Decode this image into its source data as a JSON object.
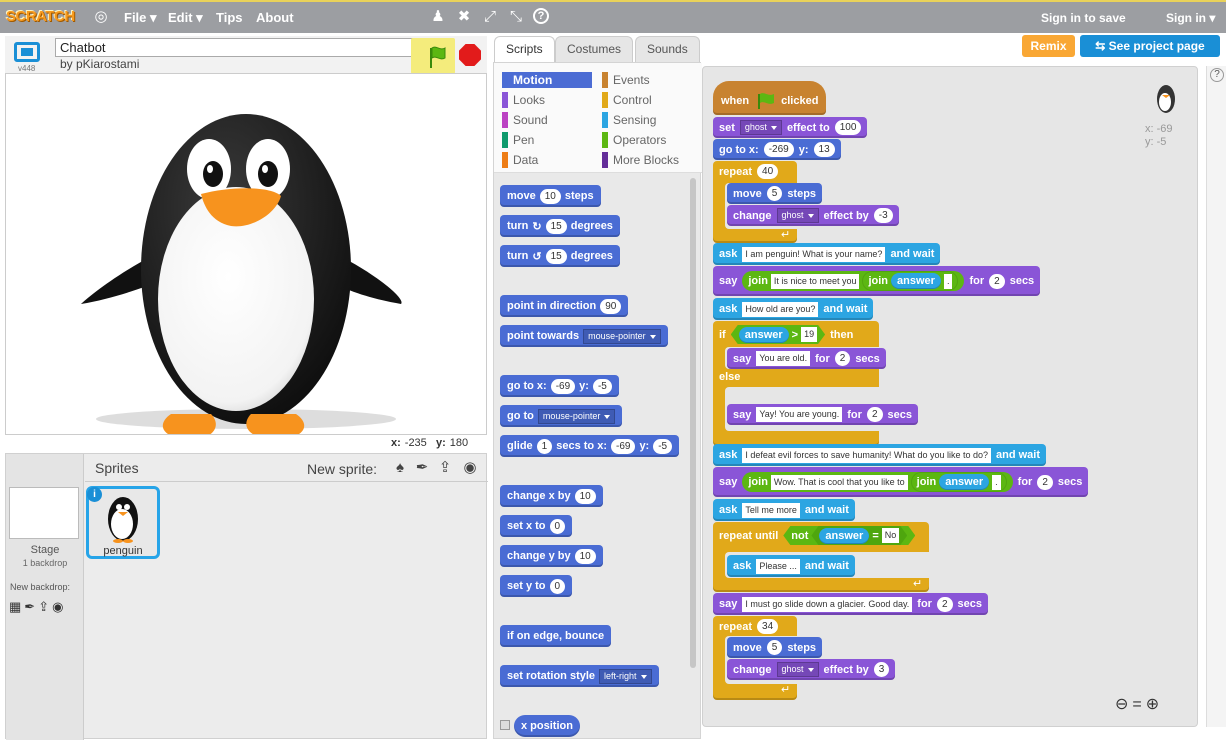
{
  "topbar": {
    "logo": "SCRATCH",
    "menu": [
      "File",
      "Edit",
      "Tips",
      "About"
    ],
    "sign_in_to_save": "Sign in to save",
    "sign_in": "Sign in",
    "icons": [
      "globe-icon",
      "duplicate-icon",
      "delete-icon",
      "grow-icon",
      "shrink-icon",
      "help-icon"
    ]
  },
  "project": {
    "title": "Chatbot",
    "author": "by pKiarostami",
    "version": "v448"
  },
  "stage": {
    "mouse_x_label": "x:",
    "mouse_x": "-235",
    "mouse_y_label": "y:",
    "mouse_y": "180"
  },
  "sprites_pane": {
    "stage_label": "Stage",
    "stage_sub": "1 backdrop",
    "new_backdrop": "New backdrop:",
    "sprites_label": "Sprites",
    "new_sprite": "New sprite:",
    "sprite_name": "penguin"
  },
  "tabs": [
    "Scripts",
    "Costumes",
    "Sounds"
  ],
  "buttons": {
    "remix": "Remix",
    "see_project": "See project page"
  },
  "categories": {
    "left": [
      "Motion",
      "Looks",
      "Sound",
      "Pen",
      "Data"
    ],
    "right": [
      "Events",
      "Control",
      "Sensing",
      "Operators",
      "More Blocks"
    ],
    "colors": {
      "Motion": "#4a6cd4",
      "Looks": "#8a55d7",
      "Sound": "#bb42c3",
      "Pen": "#0e9a6c",
      "Data": "#ee7d16",
      "Events": "#c88330",
      "Control": "#e1a91a",
      "Sensing": "#2ca5e2",
      "Operators": "#5cb712",
      "More Blocks": "#632d99"
    }
  },
  "palette": {
    "move": "move",
    "move_n": "10",
    "steps": "steps",
    "turn": "turn",
    "turn_n": "15",
    "degrees": "degrees",
    "point_dir": "point in direction",
    "point_dir_n": "90",
    "point_towards": "point towards",
    "point_towards_v": "mouse-pointer",
    "goto": "go to x:",
    "goto_x": "-69",
    "y": "y:",
    "goto_y": "-5",
    "goto2": "go to",
    "goto2_v": "mouse-pointer",
    "glide": "glide",
    "glide_n": "1",
    "secs_to_x": "secs to x:",
    "glide_x": "-69",
    "glide_y": "-5",
    "change_x": "change x by",
    "change_x_n": "10",
    "set_x": "set x to",
    "set_x_n": "0",
    "change_y": "change y by",
    "change_y_n": "10",
    "set_y": "set y to",
    "set_y_n": "0",
    "bounce": "if on edge, bounce",
    "rot_style": "set rotation style",
    "rot_style_v": "left-right",
    "xpos": "x position"
  },
  "script": {
    "when": "when",
    "clicked": "clicked",
    "set": "set",
    "ghost": "ghost",
    "effect_to": "effect to",
    "effect_val": "100",
    "goto": "go to x:",
    "x": "-269",
    "y_lbl": "y:",
    "y": "13",
    "repeat": "repeat",
    "repeat1": "40",
    "move": "move",
    "move1": "5",
    "steps": "steps",
    "change": "change",
    "effect_by": "effect by",
    "change1": "-3",
    "ask": "ask",
    "and_wait": "and wait",
    "q1": "I am penguin! What is your name?",
    "say": "say",
    "join": "join",
    "nice": "It is nice to meet you ",
    "answer": "answer",
    "dot": ".",
    "for": "for",
    "secs": "secs",
    "two": "2",
    "q2": "How old are you?",
    "if": "if",
    "gt": ">",
    "nineteen": "19",
    "then": "then",
    "old": "You are old.",
    "else": "else",
    "young": "Yay! You are young.",
    "q3": "I defeat evil forces to save humanity! What do you like to do?",
    "cool": "Wow. That is cool that you like to ",
    "q4": "Tell me more",
    "repeat_until": "repeat until",
    "not": "not",
    "eq": "=",
    "no": "No",
    "q5": "Please ...",
    "bye": "I must go slide down a glacier. Good day.",
    "repeat2": "34",
    "move2": "5",
    "change2": "3"
  },
  "sprite_info": {
    "x_label": "x:",
    "x": "-69",
    "y_label": "y:",
    "y": "-5"
  }
}
